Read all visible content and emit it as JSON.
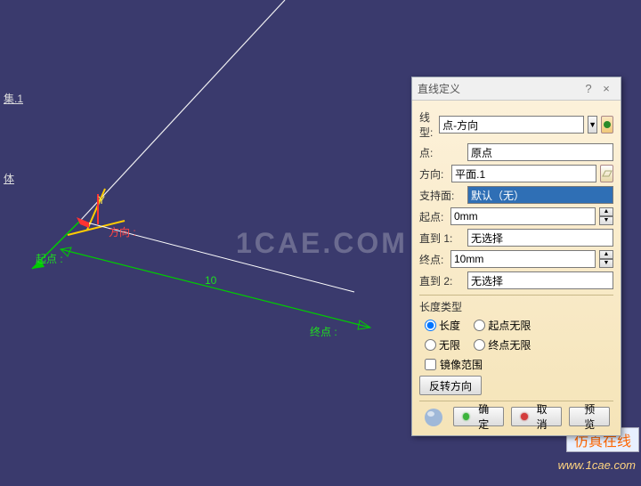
{
  "watermark": "1CAE.COM",
  "corner_tag": "仿真在线",
  "corner_url": "www.1cae.com",
  "tree": {
    "item1": "集.1",
    "item2": "体"
  },
  "canvas": {
    "axis_y": "Y",
    "start_label": "起点 :",
    "end_label": "终点 :",
    "direction_label": "方向 :",
    "dimension": "10"
  },
  "dialog": {
    "title": "直线定义",
    "help_icon": "?",
    "close_icon": "×",
    "labels": {
      "line_type": "线型:",
      "point": "点:",
      "direction": "方向:",
      "support": "支持面:",
      "start": "起点:",
      "upto1": "直到 1:",
      "end": "终点:",
      "upto2": "直到 2:",
      "length_type": "长度类型",
      "mirror": "镜像范围",
      "reverse": "反转方向",
      "ok": "确定",
      "cancel": "取消",
      "preview": "预览"
    },
    "values": {
      "line_type": "点-方向",
      "point": "原点",
      "direction": "平面.1",
      "support": "默认（无）",
      "start": "0mm",
      "upto1": "无选择",
      "end": "10mm",
      "upto2": "无选择"
    },
    "radios": {
      "r1": "长度",
      "r2": "起点无限",
      "r3": "无限",
      "r4": "终点无限",
      "selected": 0
    }
  }
}
